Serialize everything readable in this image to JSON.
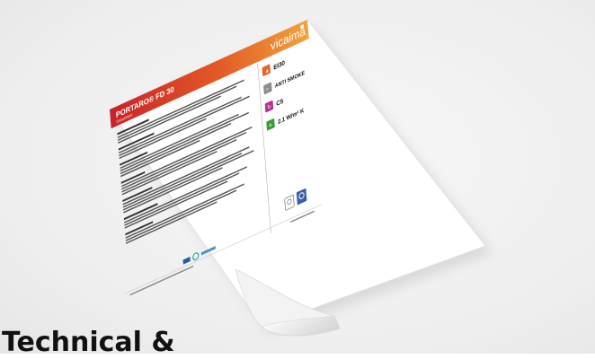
{
  "image": {
    "alt": "Vicaima Portaro FD30 product datasheet mockup"
  },
  "sheet": {
    "brand": "vicaima",
    "product_title": "PORTARO® FD 30",
    "product_subtitle": "Datasheet"
  },
  "badges": [
    {
      "label": "EI30",
      "color": "#e8622a",
      "icon": "fire-icon"
    },
    {
      "label": "ANTI SMOKE",
      "color": "#8c8c8c",
      "icon": "smoke-icon"
    },
    {
      "label": "C5",
      "color": "#b7318f",
      "icon": "door-cycle-icon"
    },
    {
      "label": "2.1 W/m² K",
      "color": "#3a9b3a",
      "icon": "thermal-icon"
    }
  ],
  "colors": {
    "header_start": "#c7222a",
    "header_end": "#f2a33a",
    "paper": "#ffffff",
    "text": "#111111"
  },
  "heading": "Technical &"
}
